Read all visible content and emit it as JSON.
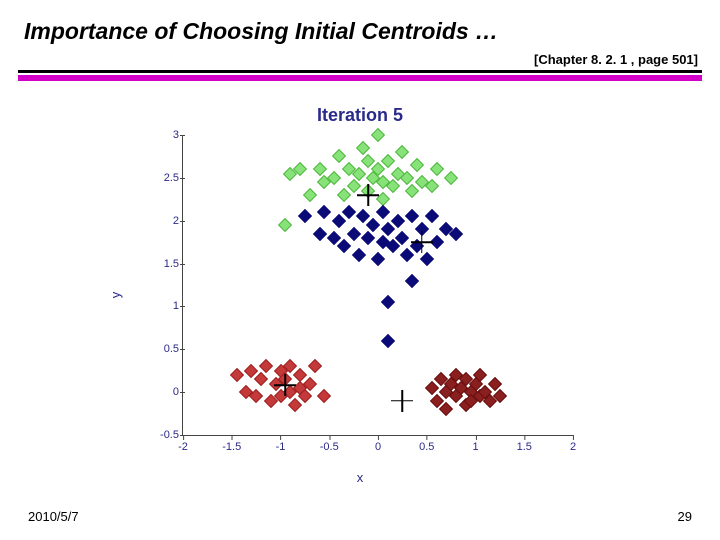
{
  "title": "Importance of Choosing Initial Centroids …",
  "reference": "[Chapter 8. 2. 1 , page 501]",
  "footer_date": "2010/5/7",
  "footer_page": "29",
  "chart_data": {
    "type": "scatter",
    "title": "Iteration 5",
    "xlabel": "x",
    "ylabel": "y",
    "xlim": [
      -2,
      2
    ],
    "ylim": [
      -0.5,
      3
    ],
    "x_ticks": [
      -2,
      -1.5,
      -1,
      -0.5,
      0,
      0.5,
      1,
      1.5,
      2
    ],
    "y_ticks": [
      -0.5,
      0,
      0.5,
      1,
      1.5,
      2,
      2.5,
      3
    ],
    "series": [
      {
        "name": "cluster-green",
        "color": "#88e27a",
        "points": [
          [
            -0.9,
            2.55
          ],
          [
            -0.8,
            2.6
          ],
          [
            -0.7,
            2.3
          ],
          [
            -0.6,
            2.6
          ],
          [
            -0.55,
            2.45
          ],
          [
            -0.45,
            2.5
          ],
          [
            -0.4,
            2.75
          ],
          [
            -0.35,
            2.3
          ],
          [
            -0.3,
            2.6
          ],
          [
            -0.25,
            2.4
          ],
          [
            -0.2,
            2.55
          ],
          [
            -0.15,
            2.85
          ],
          [
            -0.1,
            2.7
          ],
          [
            -0.1,
            2.35
          ],
          [
            -0.05,
            2.5
          ],
          [
            0.0,
            3.0
          ],
          [
            0.0,
            2.6
          ],
          [
            0.05,
            2.45
          ],
          [
            0.05,
            2.25
          ],
          [
            0.1,
            2.7
          ],
          [
            0.15,
            2.4
          ],
          [
            0.2,
            2.55
          ],
          [
            0.25,
            2.8
          ],
          [
            0.3,
            2.5
          ],
          [
            0.35,
            2.35
          ],
          [
            0.4,
            2.65
          ],
          [
            0.45,
            2.45
          ],
          [
            0.55,
            2.4
          ],
          [
            0.6,
            2.6
          ],
          [
            0.75,
            2.5
          ],
          [
            -0.95,
            1.95
          ]
        ]
      },
      {
        "name": "cluster-navy",
        "color": "#0b0b78",
        "points": [
          [
            -0.75,
            2.05
          ],
          [
            -0.6,
            1.85
          ],
          [
            -0.55,
            2.1
          ],
          [
            -0.45,
            1.8
          ],
          [
            -0.4,
            2.0
          ],
          [
            -0.35,
            1.7
          ],
          [
            -0.3,
            2.1
          ],
          [
            -0.25,
            1.85
          ],
          [
            -0.2,
            1.6
          ],
          [
            -0.15,
            2.05
          ],
          [
            -0.1,
            1.8
          ],
          [
            -0.05,
            1.95
          ],
          [
            0.0,
            1.55
          ],
          [
            0.05,
            2.1
          ],
          [
            0.05,
            1.75
          ],
          [
            0.1,
            1.9
          ],
          [
            0.15,
            1.7
          ],
          [
            0.2,
            2.0
          ],
          [
            0.25,
            1.8
          ],
          [
            0.3,
            1.6
          ],
          [
            0.35,
            2.05
          ],
          [
            0.4,
            1.7
          ],
          [
            0.45,
            1.9
          ],
          [
            0.5,
            1.55
          ],
          [
            0.55,
            2.05
          ],
          [
            0.6,
            1.75
          ],
          [
            0.7,
            1.9
          ],
          [
            0.8,
            1.85
          ],
          [
            0.35,
            1.3
          ],
          [
            0.1,
            1.05
          ],
          [
            0.1,
            0.6
          ]
        ]
      },
      {
        "name": "cluster-red",
        "color": "#c43a3a",
        "points": [
          [
            -1.45,
            0.2
          ],
          [
            -1.35,
            0.0
          ],
          [
            -1.3,
            0.25
          ],
          [
            -1.25,
            -0.05
          ],
          [
            -1.2,
            0.15
          ],
          [
            -1.15,
            0.3
          ],
          [
            -1.1,
            -0.1
          ],
          [
            -1.05,
            0.1
          ],
          [
            -1.0,
            0.25
          ],
          [
            -1.0,
            -0.05
          ],
          [
            -0.95,
            0.15
          ],
          [
            -0.9,
            0.0
          ],
          [
            -0.9,
            0.3
          ],
          [
            -0.85,
            -0.15
          ],
          [
            -0.8,
            0.2
          ],
          [
            -0.8,
            0.05
          ],
          [
            -0.75,
            -0.05
          ],
          [
            -0.7,
            0.1
          ],
          [
            -0.65,
            0.3
          ],
          [
            -0.55,
            -0.05
          ]
        ]
      },
      {
        "name": "cluster-darkred",
        "color": "#8a1f1f",
        "points": [
          [
            0.55,
            0.05
          ],
          [
            0.6,
            -0.1
          ],
          [
            0.65,
            0.15
          ],
          [
            0.7,
            0.0
          ],
          [
            0.7,
            -0.2
          ],
          [
            0.75,
            0.1
          ],
          [
            0.8,
            -0.05
          ],
          [
            0.8,
            0.2
          ],
          [
            0.85,
            0.05
          ],
          [
            0.9,
            -0.15
          ],
          [
            0.9,
            0.15
          ],
          [
            0.95,
            0.0
          ],
          [
            0.95,
            -0.1
          ],
          [
            1.0,
            0.1
          ],
          [
            1.05,
            -0.05
          ],
          [
            1.05,
            0.2
          ],
          [
            1.1,
            0.0
          ],
          [
            1.15,
            -0.1
          ],
          [
            1.2,
            0.1
          ],
          [
            1.25,
            -0.05
          ]
        ]
      }
    ],
    "centroids": [
      {
        "cluster": "green",
        "x": -0.1,
        "y": 2.3
      },
      {
        "cluster": "navy",
        "x": 0.45,
        "y": 1.75
      },
      {
        "cluster": "red",
        "x": -0.95,
        "y": 0.08
      },
      {
        "cluster": "darkred",
        "x": 0.25,
        "y": -0.1
      }
    ]
  }
}
